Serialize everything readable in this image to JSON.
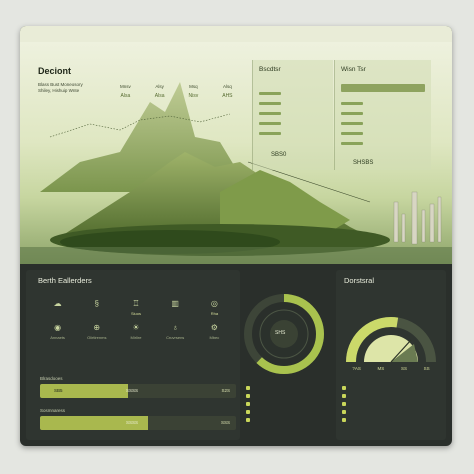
{
  "topbar": {
    "items": [
      "",
      "",
      "",
      "",
      ""
    ]
  },
  "hero": {
    "title": "Deciont",
    "subtitle_lines": [
      "Blass Bust Moneosory",
      "Shiley, Hishuip Wnte"
    ],
    "stats": [
      {
        "label": "Mnsv",
        "value": "Alsa"
      },
      {
        "label": "Alsy",
        "value": "Alsa"
      },
      {
        "label": "Msq",
        "value": "Nisv"
      },
      {
        "label": "Alsq",
        "value": "AHS"
      }
    ],
    "panel_left": {
      "title": "Bscdtsr",
      "big": "SBS0",
      "rows": [
        "",
        "",
        "",
        "",
        ""
      ]
    },
    "panel_right": {
      "title": "Wisn Tsr",
      "big": "SHSBS",
      "rows": [
        "",
        "",
        "",
        "",
        ""
      ]
    }
  },
  "left_card": {
    "title": "Berth Eallerders",
    "icons": [
      {
        "icon": "cloud-icon",
        "label": "",
        "value": ""
      },
      {
        "icon": "brand-icon",
        "label": "",
        "value": ""
      },
      {
        "icon": "trophy-icon",
        "label": "",
        "value": "Siuos"
      },
      {
        "icon": "building-icon",
        "label": "",
        "value": ""
      },
      {
        "icon": "circle-icon",
        "label": "",
        "value": "Rha"
      },
      {
        "icon": "eye-icon",
        "label": "Annaets",
        "value": ""
      },
      {
        "icon": "globe-icon",
        "label": "Olirtlrenms",
        "value": ""
      },
      {
        "icon": "sun-icon",
        "label": "Mirlire",
        "value": ""
      },
      {
        "icon": "bulb-icon",
        "label": "Cruvrsens",
        "value": ""
      },
      {
        "icon": "gear-icon",
        "label": "Mbec",
        "value": ""
      }
    ],
    "bars": [
      {
        "label": "Blrasdooes",
        "inner": "SB5",
        "mid": "SSSS",
        "end": "S2S",
        "fill": 0.45
      },
      {
        "label": "Sosmnaress",
        "inner": "",
        "mid": "SSSS",
        "end": "SSS",
        "fill": 0.55
      }
    ]
  },
  "mid_card": {
    "center": "SHS",
    "gauge_fill": 0.62,
    "legend": [
      {
        "val": "",
        "text": ""
      },
      {
        "val": "",
        "text": ""
      },
      {
        "val": "",
        "text": ""
      },
      {
        "val": "",
        "text": ""
      },
      {
        "val": "",
        "text": ""
      }
    ]
  },
  "right_card": {
    "title": "Dorstsral",
    "gauge_fill": 0.55,
    "readouts": [
      "?AS",
      "MS",
      "SS",
      "SS"
    ],
    "legend": [
      {
        "val": "",
        "text": ""
      },
      {
        "val": "",
        "text": ""
      },
      {
        "val": "",
        "text": ""
      },
      {
        "val": "",
        "text": ""
      },
      {
        "val": "",
        "text": ""
      }
    ]
  },
  "colors": {
    "accent": "#a9b84e",
    "dark": "#2a2f2b",
    "light_green": "#c9d65a"
  }
}
